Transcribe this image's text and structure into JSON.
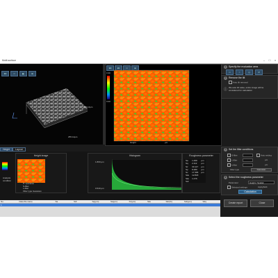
{
  "window": {
    "title": "Multi-surface",
    "controls": [
      "–",
      "□",
      "×"
    ]
  },
  "toolbar": {
    "buttons": [
      "3D",
      "□",
      "◧",
      "⊞"
    ]
  },
  "view3d": {
    "axis_y": "256.14μm",
    "axis_x": "255.14μm"
  },
  "view2d": {
    "toolbar_labels": [
      "3D",
      "2D",
      "□",
      "⊞"
    ],
    "scale_top": "0.30",
    "scale_bottom": "0.00",
    "axis_label": "Height",
    "axis_unit": "μm"
  },
  "right_panel": {
    "section1": {
      "number": "1",
      "title": "Specify the evaluation area"
    },
    "section2": {
      "number": "2",
      "title": "Remove the tilt",
      "check": "Auto tilt removal",
      "info": "We auto tilt value, entire image will be considered for calculation"
    },
    "section3": {
      "number": "3",
      "title": "Set the filter conditions",
      "rows": [
        {
          "label": "S-filter",
          "value": "",
          "action": "Auto setting"
        },
        {
          "label": "L-filter",
          "value": "",
          "unit": "μm"
        },
        {
          "label": "λ-filter",
          "value": "",
          "unit": "μm"
        }
      ],
      "filter_type_label": "Filter type",
      "filter_type_value": "Gaussian"
    },
    "section4": {
      "number": "4",
      "title": "Select the roughness parameter",
      "dropdown_label": "Parameter",
      "dropdown_value": "Height / Spatial",
      "sub_label": "Selected settings",
      "sub_value": "Apply/Edit"
    },
    "calculate_button": "Calculation",
    "create_report_button": "Create report",
    "close_button": "Close"
  },
  "tabs": [
    "Height",
    "Layout"
  ],
  "bottom": {
    "height_image_title": "Height image",
    "histogram_title": "Histogram",
    "roughness_title": "Roughness parameter",
    "legend_lines": [
      "P: operation",
      "S-filter",
      "L-filter",
      "Filter type",
      "Gaussian"
    ],
    "side_label_1": "Analysis",
    "side_label_2": "condition",
    "histogram_top": "1.800 μm",
    "histogram_mid": "0.540 μm",
    "roughness_rows": [
      {
        "p": "Sa",
        "v": "1.469",
        "u": "μm"
      },
      {
        "p": "Sq",
        "v": "2.112",
        "u": "μm"
      },
      {
        "p": "Sz",
        "v": "30.117",
        "u": "μm"
      },
      {
        "p": "Sp",
        "v": "8.280",
        "u": "μm"
      },
      {
        "p": "Sv",
        "v": "17.366",
        "u": "μm"
      },
      {
        "p": "Ssk",
        "v": "12.818",
        "u": ""
      },
      {
        "p": "Sku",
        "v": "1.476",
        "u": ""
      },
      {
        "p": "Sdr",
        "v": "",
        "u": ""
      }
    ]
  },
  "table": {
    "headers": [
      "No.",
      "Data file name",
      "Sa",
      "Sdr",
      "Sq(μm)",
      "Sa(μm)",
      "Sz(μm)",
      "Sku",
      "Sdr(%)",
      "Sdr(μm)",
      "Sdq"
    ],
    "selected_row": [
      "1",
      "",
      "",
      "",
      "",
      "",
      "",
      "",
      "",
      "",
      ""
    ]
  },
  "colors": {
    "window_bg": "#1b1b1b",
    "panel_bg": "#262626",
    "accent_blue": "#2b5d85",
    "selection_blue": "#3b7bd8",
    "map_orange": "#ff5a00",
    "map_green": "#3fd12a"
  }
}
